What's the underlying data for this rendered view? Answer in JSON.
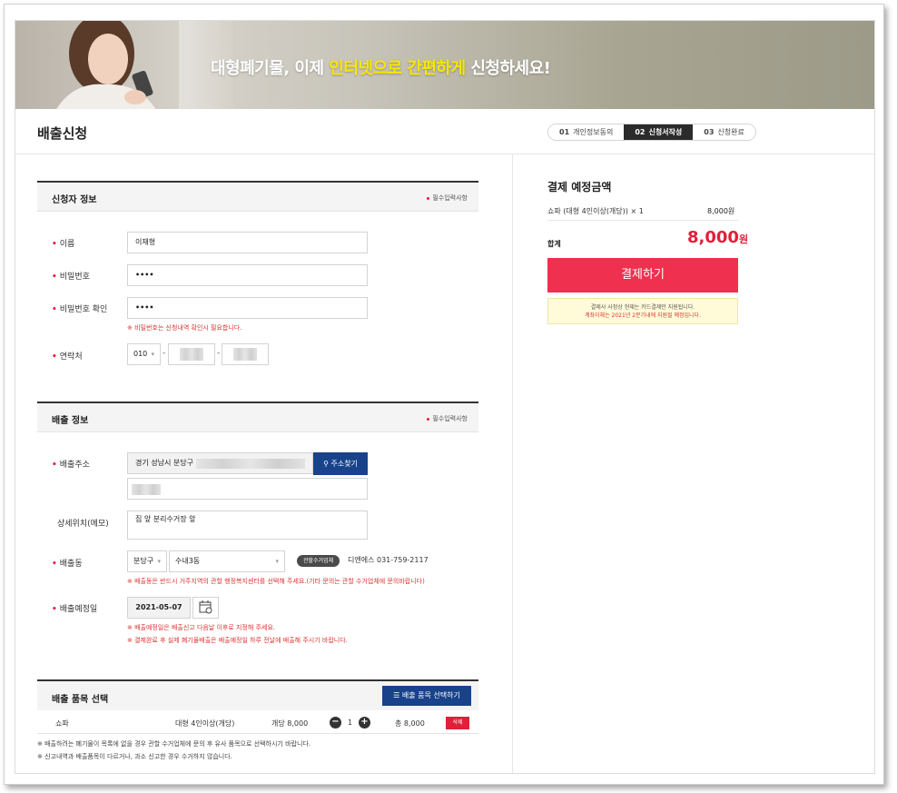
{
  "banner": {
    "headline_pre": "대형폐기물, 이제 ",
    "headline_highlight": "인터넷으로 간편하게",
    "headline_post": " 신청하세요!"
  },
  "page": {
    "title": "배출신청",
    "steps": [
      {
        "num": "01",
        "label": "개인정보동의"
      },
      {
        "num": "02",
        "label": "신청서작성"
      },
      {
        "num": "03",
        "label": "신청완료"
      }
    ]
  },
  "applicant": {
    "section_title": "신청자 정보",
    "required_note": "필수입력사항",
    "name_label": "이름",
    "name_value": "이재형",
    "password_label": "비밀번호",
    "password_value": "••••",
    "password_confirm_label": "비밀번호 확인",
    "password_confirm_value": "••••",
    "password_note": "※ 비밀번호는 신청내역 확인시 필요합니다.",
    "phone_label": "연락처",
    "phone_prefix": "010",
    "phone_dash": "-"
  },
  "disposal": {
    "section_title": "배출 정보",
    "required_note": "필수입력사항",
    "address_label": "배출주소",
    "address_value": "경기 성남시 분당구",
    "address_button": "주소찾기",
    "memo_label": "상세위치(메모)",
    "memo_value": "집 앞 분리수거장 앞",
    "dong_label": "배출동",
    "gu_value": "분당구",
    "dong_value": "수내3동",
    "collector_badge": "관할수거업체",
    "collector_value": "디엔에스 031-759-2117",
    "dong_note": "※ 배출동은 반드시 거주지역의 관할 행정복지센터를 선택해 주세요.(기타 문의는 관할 수거업체에 문의바랍니다)",
    "date_label": "배출예정일",
    "date_value": "2021-05-07",
    "date_note1": "※ 배출예정일은 배출신고 다음날 이후로 지정해 주세요.",
    "date_note2": "※ 결제완료 후 실제 폐기물배출은 배출예정일 하루 전날에 배출해 주시기 바랍니다."
  },
  "items": {
    "section_title": "배출 품목 선택",
    "select_button": "배출 품목 선택하기",
    "rows": [
      {
        "name": "쇼파",
        "spec": "대형 4인이상(개당)",
        "unit_price": "개당 8,000",
        "qty": "1",
        "total": "총 8,000",
        "delete": "삭제"
      }
    ],
    "note1": "※ 배출하려는 폐기물이 목록에 없을 경우 관할 수거업체에 문의 후 유사 품목으로 선택하시기 바랍니다.",
    "note2": "※ 신고내역과 배출품목이 다르거나, 과소 신고한 경우 수거하지 않습니다."
  },
  "payment": {
    "title": "결제 예정금액",
    "item_desc": "쇼파 (대형 4인이상(개당)) × 1",
    "item_price": "8,000원",
    "total_label": "합계",
    "total_value": "8,000",
    "total_unit": "원",
    "pay_button": "결제하기",
    "note1": "결제사 사정상 현재는 카드결제만 지원됩니다.",
    "note2": "계좌이체는 2021년 2분기내에 지원될 예정입니다."
  },
  "colors": {
    "accent_red": "#f0304f",
    "primary_blue": "#18428a",
    "banner_highlight": "#f7e600"
  }
}
